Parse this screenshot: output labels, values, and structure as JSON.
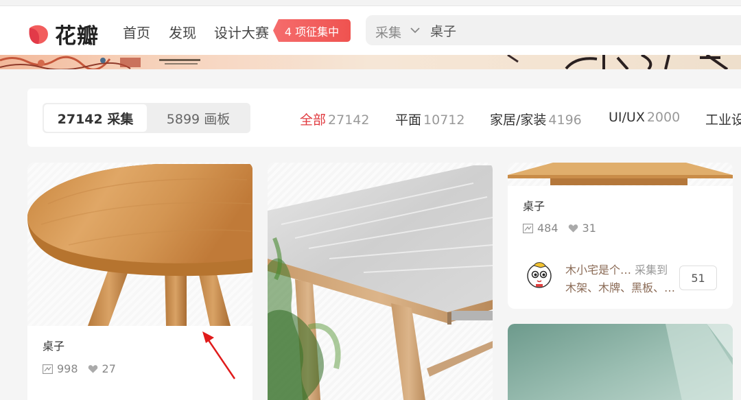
{
  "header": {
    "logo_text": "花瓣",
    "nav": [
      "首页",
      "发现",
      "设计大赛"
    ],
    "contest_badge": "4 项征集中",
    "search": {
      "scope": "采集",
      "value": "桌子"
    }
  },
  "filter_bar": {
    "segments": [
      {
        "label": "27142 采集",
        "active": true
      },
      {
        "label": "5899 画板",
        "active": false
      }
    ],
    "categories": [
      {
        "label": "全部",
        "count": "27142",
        "active": true
      },
      {
        "label": "平面",
        "count": "10712"
      },
      {
        "label": "家居/家装",
        "count": "4196"
      },
      {
        "label": "UI/UX",
        "count": "2000"
      },
      {
        "label": "工业设",
        "count": ""
      }
    ]
  },
  "cards": [
    {
      "title": "桌子",
      "repins": "998",
      "likes": "27"
    },
    {
      "title": "",
      "repins": "",
      "likes": ""
    },
    {
      "title": "桌子",
      "repins": "484",
      "likes": "31",
      "author": "木小宅是个…",
      "action": "采集到",
      "boards": "木架、木牌、黑板、…",
      "board_count": "51"
    }
  ],
  "colors": {
    "accent": "#e0393e",
    "brand": "#f25d5d"
  }
}
